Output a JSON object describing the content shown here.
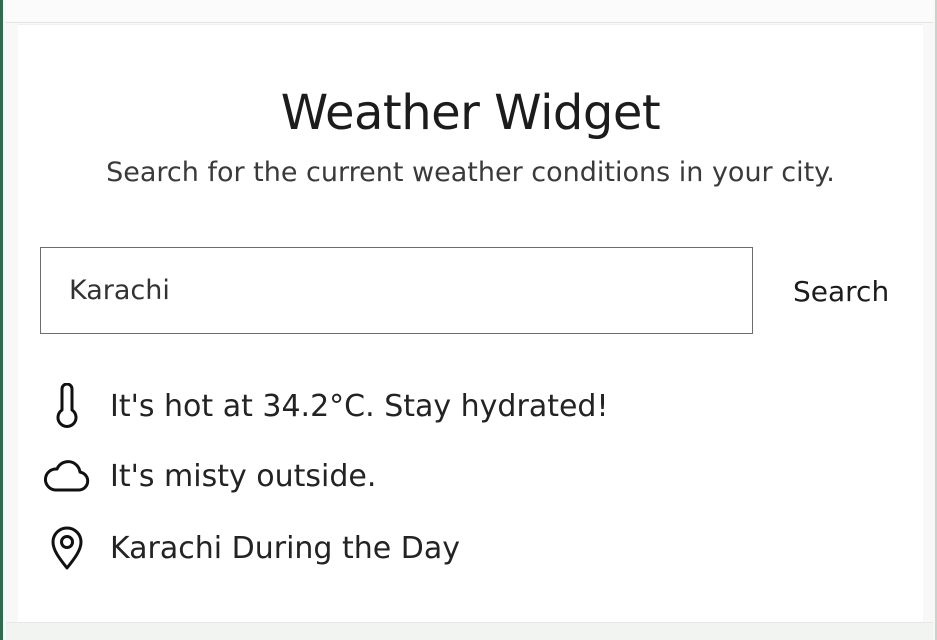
{
  "widget": {
    "title": "Weather Widget",
    "subtitle": "Search for the current weather conditions in your city."
  },
  "search": {
    "value": "Karachi",
    "button_label": "Search"
  },
  "results": [
    {
      "icon": "thermometer-icon",
      "text": "It's hot at 34.2°C. Stay hydrated!"
    },
    {
      "icon": "cloud-icon",
      "text": "It's misty outside."
    },
    {
      "icon": "location-pin-icon",
      "text": "Karachi During the Day"
    }
  ],
  "colors": {
    "text": "#1c1c1c",
    "border": "#6d6d6d",
    "background": "#ffffff"
  }
}
